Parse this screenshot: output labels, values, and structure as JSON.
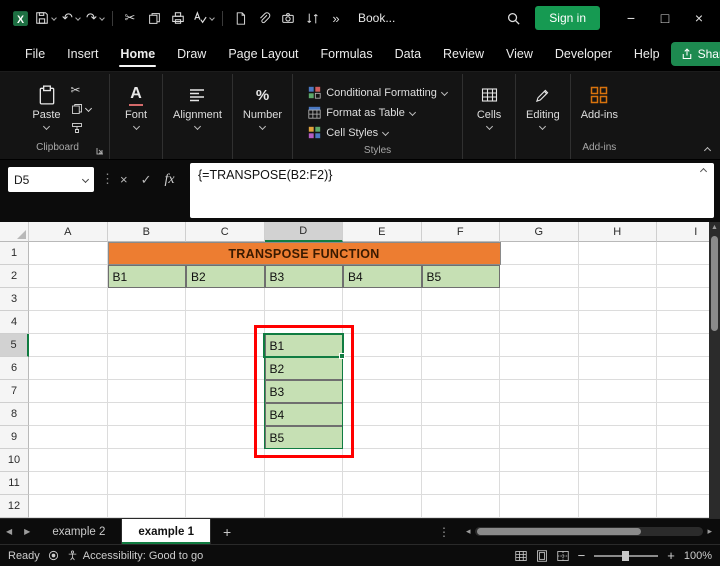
{
  "titlebar": {
    "workbook_title": "Book...",
    "sign_in": "Sign in"
  },
  "menubar": {
    "items": [
      "File",
      "Insert",
      "Home",
      "Draw",
      "Page Layout",
      "Formulas",
      "Data",
      "Review",
      "View",
      "Developer",
      "Help"
    ],
    "active_item": "Home",
    "share": "Share"
  },
  "ribbon": {
    "paste": "Paste",
    "clipboard_group": "Clipboard",
    "font": "Font",
    "alignment": "Alignment",
    "number": "Number",
    "conditional_formatting": "Conditional Formatting",
    "format_as_table": "Format as Table",
    "cell_styles": "Cell Styles",
    "styles_group": "Styles",
    "cells": "Cells",
    "editing": "Editing",
    "addins": "Add-ins",
    "addins_group": "Add-ins"
  },
  "formula_bar": {
    "name_box": "D5",
    "fx": "fx",
    "formula": "{=TRANSPOSE(B2:F2)}"
  },
  "grid": {
    "columns": [
      "A",
      "B",
      "C",
      "D",
      "E",
      "F",
      "G",
      "H",
      "I"
    ],
    "row_count": 12,
    "selected_column": "D",
    "selected_row": 5,
    "banner_text": "TRANSPOSE FUNCTION",
    "row2_values": [
      "B1",
      "B2",
      "B3",
      "B4",
      "B5"
    ],
    "transposed_values": [
      "B1",
      "B2",
      "B3",
      "B4",
      "B5"
    ],
    "colors": {
      "banner_bg": "#ED7D31",
      "cell_green": "#C6E0B4",
      "annotation_red": "#FF0000",
      "accent_green": "#107C41"
    }
  },
  "sheet_tabs": {
    "tabs": [
      "example 2",
      "example 1"
    ],
    "active_tab": "example 1",
    "add": "+"
  },
  "status_bar": {
    "ready": "Ready",
    "accessibility": "Accessibility: Good to go",
    "zoom": "100%"
  },
  "icons": {
    "undo": "↶",
    "redo": "↷",
    "cut": "✂",
    "overflow": "»",
    "dots": "⋮",
    "minimize": "−",
    "maximize": "□",
    "close": "×",
    "cancel": "×",
    "enter": "✓",
    "tab_left": "◀",
    "tab_right": "▶",
    "scroll_left": "◂",
    "scroll_right": "▸",
    "scroll_up": "▲"
  }
}
